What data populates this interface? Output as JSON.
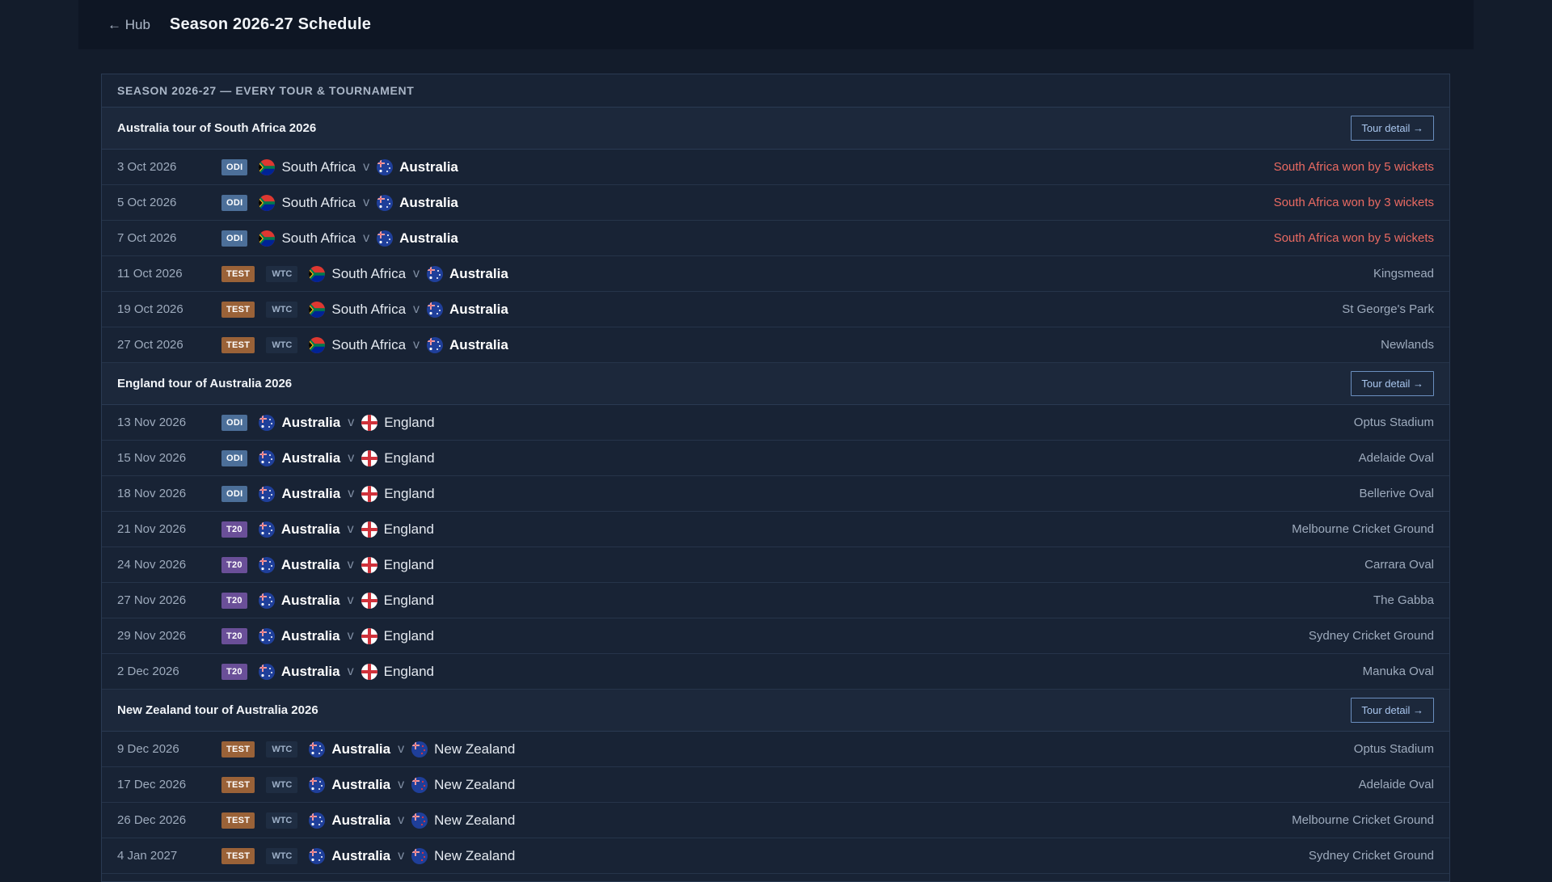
{
  "header": {
    "back_label": "← Hub",
    "title": "Season 2026‑27 Schedule"
  },
  "panel": {
    "title": "Season 2026‑27 — Every tour & tournament"
  },
  "tours": [
    {
      "name": "Australia tour of South Africa 2026",
      "button": "Tour detail →",
      "matches": [
        {
          "date": "3 Oct 2026",
          "format": "ODI",
          "wtc": "",
          "home": "South Africa",
          "away": "Australia",
          "strong": "away",
          "right": "South Africa won by 5 wickets",
          "right_type": "result"
        },
        {
          "date": "5 Oct 2026",
          "format": "ODI",
          "wtc": "",
          "home": "South Africa",
          "away": "Australia",
          "strong": "away",
          "right": "South Africa won by 3 wickets",
          "right_type": "result"
        },
        {
          "date": "7 Oct 2026",
          "format": "ODI",
          "wtc": "",
          "home": "South Africa",
          "away": "Australia",
          "strong": "away",
          "right": "South Africa won by 5 wickets",
          "right_type": "result"
        },
        {
          "date": "11 Oct 2026",
          "format": "TEST",
          "wtc": "WTC",
          "home": "South Africa",
          "away": "Australia",
          "strong": "away",
          "right": "Kingsmead",
          "right_type": "venue"
        },
        {
          "date": "19 Oct 2026",
          "format": "TEST",
          "wtc": "WTC",
          "home": "South Africa",
          "away": "Australia",
          "strong": "away",
          "right": "St George's Park",
          "right_type": "venue"
        },
        {
          "date": "27 Oct 2026",
          "format": "TEST",
          "wtc": "WTC",
          "home": "South Africa",
          "away": "Australia",
          "strong": "away",
          "right": "Newlands",
          "right_type": "venue"
        }
      ]
    },
    {
      "name": "England tour of Australia 2026",
      "button": "Tour detail →",
      "matches": [
        {
          "date": "13 Nov 2026",
          "format": "ODI",
          "wtc": "",
          "home": "Australia",
          "away": "England",
          "strong": "home",
          "right": "Optus Stadium",
          "right_type": "venue"
        },
        {
          "date": "15 Nov 2026",
          "format": "ODI",
          "wtc": "",
          "home": "Australia",
          "away": "England",
          "strong": "home",
          "right": "Adelaide Oval",
          "right_type": "venue"
        },
        {
          "date": "18 Nov 2026",
          "format": "ODI",
          "wtc": "",
          "home": "Australia",
          "away": "England",
          "strong": "home",
          "right": "Bellerive Oval",
          "right_type": "venue"
        },
        {
          "date": "21 Nov 2026",
          "format": "T20",
          "wtc": "",
          "home": "Australia",
          "away": "England",
          "strong": "home",
          "right": "Melbourne Cricket Ground",
          "right_type": "venue"
        },
        {
          "date": "24 Nov 2026",
          "format": "T20",
          "wtc": "",
          "home": "Australia",
          "away": "England",
          "strong": "home",
          "right": "Carrara Oval",
          "right_type": "venue"
        },
        {
          "date": "27 Nov 2026",
          "format": "T20",
          "wtc": "",
          "home": "Australia",
          "away": "England",
          "strong": "home",
          "right": "The Gabba",
          "right_type": "venue"
        },
        {
          "date": "29 Nov 2026",
          "format": "T20",
          "wtc": "",
          "home": "Australia",
          "away": "England",
          "strong": "home",
          "right": "Sydney Cricket Ground",
          "right_type": "venue"
        },
        {
          "date": "2 Dec 2026",
          "format": "T20",
          "wtc": "",
          "home": "Australia",
          "away": "England",
          "strong": "home",
          "right": "Manuka Oval",
          "right_type": "venue"
        }
      ]
    },
    {
      "name": "New Zealand tour of Australia 2026",
      "button": "Tour detail →",
      "matches": [
        {
          "date": "9 Dec 2026",
          "format": "TEST",
          "wtc": "WTC",
          "home": "Australia",
          "away": "New Zealand",
          "strong": "home",
          "right": "Optus Stadium",
          "right_type": "venue"
        },
        {
          "date": "17 Dec 2026",
          "format": "TEST",
          "wtc": "WTC",
          "home": "Australia",
          "away": "New Zealand",
          "strong": "home",
          "right": "Adelaide Oval",
          "right_type": "venue"
        },
        {
          "date": "26 Dec 2026",
          "format": "TEST",
          "wtc": "WTC",
          "home": "Australia",
          "away": "New Zealand",
          "strong": "home",
          "right": "Melbourne Cricket Ground",
          "right_type": "venue"
        },
        {
          "date": "4 Jan 2027",
          "format": "TEST",
          "wtc": "WTC",
          "home": "Australia",
          "away": "New Zealand",
          "strong": "home",
          "right": "Sydney Cricket Ground",
          "right_type": "venue"
        }
      ]
    }
  ],
  "colors": {
    "result": "#ea6a62",
    "odi": "#4c6f99",
    "test": "#9a6238",
    "t20": "#6a4f98"
  },
  "flag_icons": {
    "South Africa": "south-africa-flag-icon",
    "Australia": "australia-flag-icon",
    "England": "england-flag-icon",
    "New Zealand": "new-zealand-flag-icon"
  }
}
